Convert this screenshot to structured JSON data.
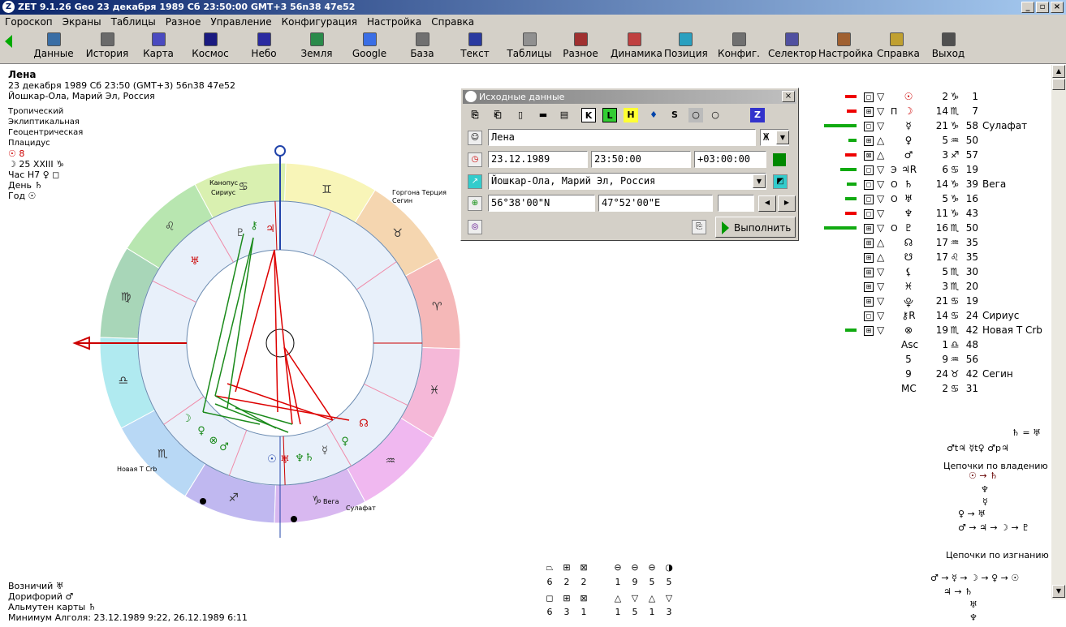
{
  "window": {
    "title": "ZET 9.1.26 Geo   23 декабря 1989  Сб  23:50:00 GMT+3 56n38  47e52",
    "minimize": "_",
    "restore": "▫",
    "close": "×"
  },
  "menu": [
    "Гороскоп",
    "Экраны",
    "Таблицы",
    "Разное",
    "Управление",
    "Конфигурация",
    "Настройка",
    "Справка"
  ],
  "toolbar": [
    {
      "label": "Данные",
      "icon": "data-icon",
      "color": "#3a6ea5"
    },
    {
      "label": "История",
      "icon": "history-icon",
      "color": "#6a6a6a"
    },
    {
      "label": "Карта",
      "icon": "chart-map-icon",
      "color": "#4a4ac0"
    },
    {
      "label": "Космос",
      "icon": "cosmos-icon",
      "color": "#1a1a80"
    },
    {
      "label": "Небо",
      "icon": "sky-icon",
      "color": "#2a2aa0"
    },
    {
      "label": "Земля",
      "icon": "earth-icon",
      "color": "#2a8a4a"
    },
    {
      "label": "Google",
      "icon": "google-icon",
      "color": "#3a6ee5"
    },
    {
      "label": "База",
      "icon": "database-icon",
      "color": "#707070"
    },
    {
      "label": "Текст",
      "icon": "text-icon",
      "color": "#2a3aa0"
    },
    {
      "label": "Таблицы",
      "icon": "tables-icon",
      "color": "#909090"
    },
    {
      "label": "Разное",
      "icon": "misc-icon",
      "color": "#a03030"
    },
    {
      "label": "Динамика",
      "icon": "dynamics-icon",
      "color": "#c04040"
    },
    {
      "label": "Позиция",
      "icon": "position-icon",
      "color": "#2aa0c0"
    },
    {
      "label": "Конфиг.",
      "icon": "config-icon",
      "color": "#707070"
    },
    {
      "label": "Селектор",
      "icon": "selector-icon",
      "color": "#5050a0"
    },
    {
      "label": "Настройка",
      "icon": "settings-icon",
      "color": "#a06030"
    },
    {
      "label": "Справка",
      "icon": "help-icon",
      "color": "#c0a030"
    },
    {
      "label": "Выход",
      "icon": "exit-icon",
      "color": "#505050"
    }
  ],
  "info": {
    "name": "Лена",
    "datetime": "23 декабря 1989  Сб  23:50 (GMT+3) 56n38  47e52",
    "place": "Йошкар-Ола, Марий Эл, Россия",
    "settings": [
      "Тропический",
      "Эклиптикальная",
      "Геоцентрическая",
      "Плацидус"
    ],
    "extra": [
      "☉  8",
      "☽  25 XXIII ♑",
      "Час H7  ♀  ◻",
      "День  ♄",
      "Год  ☉"
    ]
  },
  "bottom_left": [
    "Возничий  ♅",
    "Дорифорий  ♂",
    "Альмутен карты  ♄",
    "Минимум Алголя: 23.12.1989  9:22,  26.12.1989  6:11"
  ],
  "dialog": {
    "title": "Исходные данные",
    "tools": [
      "⎘",
      "⎗",
      "▯",
      "▬",
      "▤",
      "K",
      "L",
      "H",
      "♦",
      "S",
      "○",
      "○",
      "Z"
    ],
    "name": "Лена",
    "gender": "Ж",
    "date": "23.12.1989",
    "time": "23:50:00",
    "tz": "+03:00:00",
    "place": "Йошкар-Ола, Марий Эл, Россия",
    "lat": "56°38'00\"N",
    "lon": "47°52'00\"E",
    "prev": "◀",
    "next": "▶",
    "execute": "Выполнить"
  },
  "planets": [
    {
      "bar": "red",
      "barw": 14,
      "box": "◻",
      "asp": "▽",
      "rx": "",
      "glyph": "☉",
      "deg": "2",
      "sign": "♑",
      "min": "1",
      "star": ""
    },
    {
      "bar": "red",
      "barw": 12,
      "box": "⊞",
      "asp": "▽",
      "rx": "Π",
      "glyph": "☽",
      "deg": "14",
      "sign": "♏",
      "min": "7",
      "star": ""
    },
    {
      "bar": "green",
      "barw": 40,
      "box": "◻",
      "asp": "▽",
      "rx": "",
      "glyph": "☿",
      "deg": "21",
      "sign": "♑",
      "min": "58",
      "star": "Сулафат"
    },
    {
      "bar": "green",
      "barw": 10,
      "box": "⊞",
      "asp": "△",
      "rx": "",
      "glyph": "♀",
      "deg": "5",
      "sign": "♒",
      "min": "50",
      "star": ""
    },
    {
      "bar": "red",
      "barw": 14,
      "box": "⊠",
      "asp": "△",
      "rx": "",
      "glyph": "♂",
      "deg": "3",
      "sign": "♐",
      "min": "57",
      "star": ""
    },
    {
      "bar": "green",
      "barw": 20,
      "box": "◻",
      "asp": "▽",
      "rx": "Э",
      "glyph": "♃R",
      "deg": "6",
      "sign": "♋",
      "min": "19",
      "star": ""
    },
    {
      "bar": "green",
      "barw": 12,
      "box": "◻",
      "asp": "▽",
      "rx": "О",
      "glyph": "♄",
      "deg": "14",
      "sign": "♑",
      "min": "39",
      "star": "Вега"
    },
    {
      "bar": "green",
      "barw": 14,
      "box": "◻",
      "asp": "▽",
      "rx": "О",
      "glyph": "♅",
      "deg": "5",
      "sign": "♑",
      "min": "16",
      "star": ""
    },
    {
      "bar": "red",
      "barw": 14,
      "box": "◻",
      "asp": "▽",
      "rx": "",
      "glyph": "♆",
      "deg": "11",
      "sign": "♑",
      "min": "43",
      "star": ""
    },
    {
      "bar": "green",
      "barw": 40,
      "box": "⊞",
      "asp": "▽",
      "rx": "О",
      "glyph": "♇",
      "deg": "16",
      "sign": "♏",
      "min": "50",
      "star": ""
    },
    {
      "bar": "",
      "barw": 0,
      "box": "⊞",
      "asp": "△",
      "rx": "",
      "glyph": "☊",
      "deg": "17",
      "sign": "♒",
      "min": "35",
      "star": ""
    },
    {
      "bar": "",
      "barw": 0,
      "box": "⊞",
      "asp": "△",
      "rx": "",
      "glyph": "☋",
      "deg": "17",
      "sign": "♌",
      "min": "35",
      "star": ""
    },
    {
      "bar": "",
      "barw": 0,
      "box": "⊞",
      "asp": "▽",
      "rx": "",
      "glyph": "⚸",
      "deg": "5",
      "sign": "♏",
      "min": "30",
      "star": ""
    },
    {
      "bar": "",
      "barw": 0,
      "box": "⊞",
      "asp": "▽",
      "rx": "",
      "glyph": "♓︎",
      "deg": "3",
      "sign": "♏",
      "min": "20",
      "star": ""
    },
    {
      "bar": "",
      "barw": 0,
      "box": "⊞",
      "asp": "▽",
      "rx": "",
      "glyph": "⯓",
      "deg": "21",
      "sign": "♋",
      "min": "19",
      "star": ""
    },
    {
      "bar": "",
      "barw": 0,
      "box": "◻",
      "asp": "▽",
      "rx": "",
      "glyph": "⚷R",
      "deg": "14",
      "sign": "♋",
      "min": "24",
      "star": "Сириус"
    },
    {
      "bar": "green",
      "barw": 14,
      "box": "⊞",
      "asp": "▽",
      "rx": "",
      "glyph": "⊗",
      "deg": "19",
      "sign": "♏",
      "min": "42",
      "star": "Новая T Crb"
    },
    {
      "bar": "",
      "barw": 0,
      "box": "",
      "asp": "",
      "rx": "",
      "glyph": "Asc",
      "deg": "1",
      "sign": "♎",
      "min": "48",
      "star": ""
    },
    {
      "bar": "",
      "barw": 0,
      "box": "",
      "asp": "",
      "rx": "",
      "glyph": "5",
      "deg": "9",
      "sign": "♒",
      "min": "56",
      "star": ""
    },
    {
      "bar": "",
      "barw": 0,
      "box": "",
      "asp": "",
      "rx": "",
      "glyph": "9",
      "deg": "24",
      "sign": "♉",
      "min": "42",
      "star": "Сегин"
    },
    {
      "bar": "",
      "barw": 0,
      "box": "",
      "asp": "",
      "rx": "",
      "glyph": "MC",
      "deg": "2",
      "sign": "♋",
      "min": "31",
      "star": ""
    }
  ],
  "chains": {
    "top1": "♄ = ♅",
    "top2": "♂t♃  ☿t♀  ♂p♃",
    "rule_title": "Цепочки по владению",
    "rule_lines": [
      "☉ → ♄",
      "♆",
      "☿",
      "♀ → ♅",
      "♂ → ♃ → ☽ → ♇"
    ],
    "exile_title": "Цепочки по изгнанию",
    "exile_lines": [
      "♂ → ☿ → ☽ → ♀ → ☉",
      "♃ → ♄",
      "♅",
      "♆"
    ]
  },
  "counts": {
    "row1_icons": [
      "⏢",
      "⊞",
      "⊠",
      "⊖",
      "⊖",
      "◑"
    ],
    "row1_vals": [
      "6",
      "2",
      "2",
      "1",
      "9",
      "5",
      "5"
    ],
    "row2_icons": [
      "◻",
      "⊞",
      "⊠",
      "△",
      "▽",
      "△",
      "▽"
    ],
    "row2_vals": [
      "6",
      "3",
      "1",
      "1",
      "5",
      "1",
      "3"
    ]
  },
  "wheel": {
    "signs": [
      "♈",
      "♉",
      "♊",
      "♋",
      "♌",
      "♍",
      "♎",
      "♏",
      "♐",
      "♑",
      "♒",
      "♓"
    ],
    "sign_colors": [
      "#f5b8b8",
      "#f5d6b0",
      "#f8f5b8",
      "#d9f0b0",
      "#b8e6b0",
      "#a8d6b8",
      "#b0eaf0",
      "#b8d8f5",
      "#c0b8f0",
      "#d8b8f0",
      "#f0b8f0",
      "#f5b8d8"
    ],
    "stars": [
      "Канопус",
      "Сириус",
      "Горгона Терция",
      "Сегин",
      "Новая T Crb",
      "Вега",
      "Сулафат"
    ]
  }
}
